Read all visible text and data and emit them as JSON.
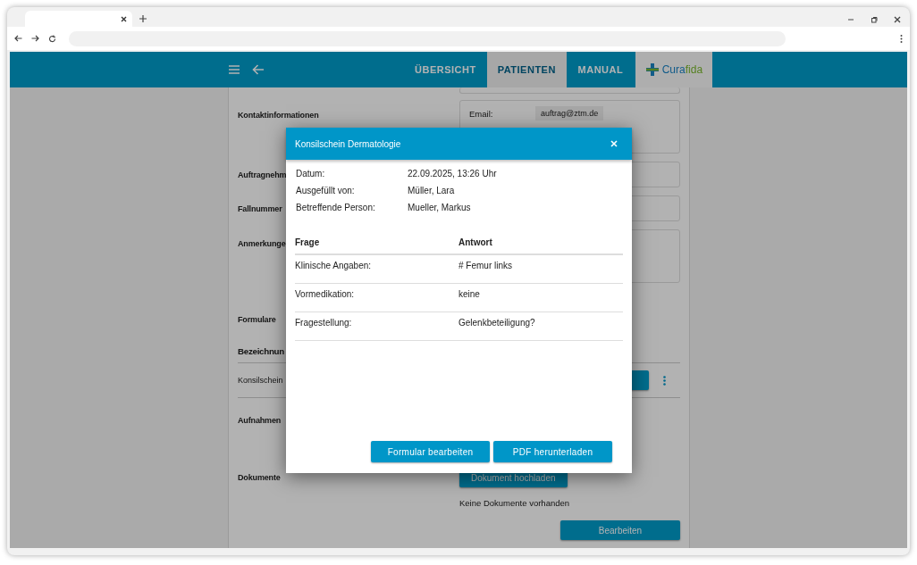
{
  "nav": {
    "tabs": [
      {
        "label": "ÜBERSICHT",
        "selected": false
      },
      {
        "label": "PATIENTEN",
        "selected": true
      },
      {
        "label": "MANUAL",
        "selected": false
      }
    ],
    "logo": [
      "Cura",
      "fida"
    ]
  },
  "page": {
    "contact": {
      "label": "Kontaktinformationen",
      "fields": [
        {
          "label": "Email:",
          "value": "auftrag@ztm.de"
        }
      ]
    },
    "fields": [
      {
        "label": "Auftragnehm",
        "tall": false
      },
      {
        "label": "Fallnummer",
        "tall": false
      },
      {
        "label": "Anmerkunge",
        "tall": true
      }
    ],
    "forms": {
      "label": "Formulare",
      "column": "Bezeichnun",
      "rows": [
        "Konsilschein"
      ]
    },
    "images": {
      "label": "Aufnahmen"
    },
    "documents": {
      "label": "Dokumente",
      "button": "Dokument hochladen",
      "empty": "Keine Dokumente vorhanden"
    },
    "edit_button": "Bearbeiten"
  },
  "dialog": {
    "title": "Konsilschein Dermatologie",
    "meta": [
      {
        "label": "Datum:",
        "value": "22.09.2025, 13:26 Uhr"
      },
      {
        "label": "Ausgefüllt von:",
        "value": "Müller, Lara"
      },
      {
        "label": "Betreffende Person:",
        "value": "Mueller, Markus"
      }
    ],
    "columns": [
      "Frage",
      "Antwort"
    ],
    "rows": [
      {
        "question": "Klinische Angaben:",
        "answer": "# Femur links"
      },
      {
        "question": "Vormedikation:",
        "answer": "keine"
      },
      {
        "question": "Fragestellung:",
        "answer": "Gelenkbeteiligung?"
      }
    ],
    "buttons": [
      "Formular bearbeiten",
      "PDF herunterladen"
    ]
  }
}
